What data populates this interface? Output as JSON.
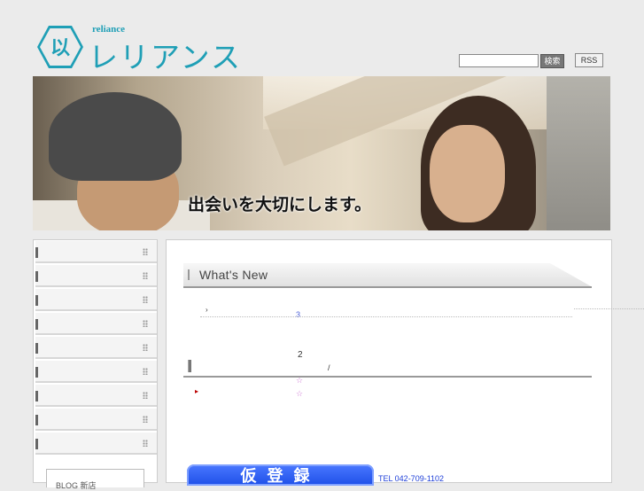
{
  "header": {
    "logo_small": "reliance",
    "logo_kana": "レリアンス",
    "logo_mark": "以",
    "search_placeholder": "",
    "search_button": "検索",
    "rss_button": "RSS"
  },
  "hero": {
    "caption": "出会いを大切にします。"
  },
  "sidebar": {
    "items": [
      "",
      "",
      "",
      "",
      "",
      "",
      "",
      "",
      ""
    ],
    "box_label": "BLOG 新店"
  },
  "main": {
    "whats_new_title": "What's New",
    "news_arrow": "›",
    "news_number_1": "3",
    "news_number_2": "2",
    "news_slash": "/",
    "news_flag": "▸",
    "star_1": "☆",
    "star_2": "☆",
    "register_button": "仮登録",
    "tel": "TEL 042-709-1102"
  },
  "colors": {
    "brand": "#1f9fb6",
    "register_button": "#1e4fe8",
    "tel_text": "#1e3fd8",
    "background": "#ebebeb"
  }
}
